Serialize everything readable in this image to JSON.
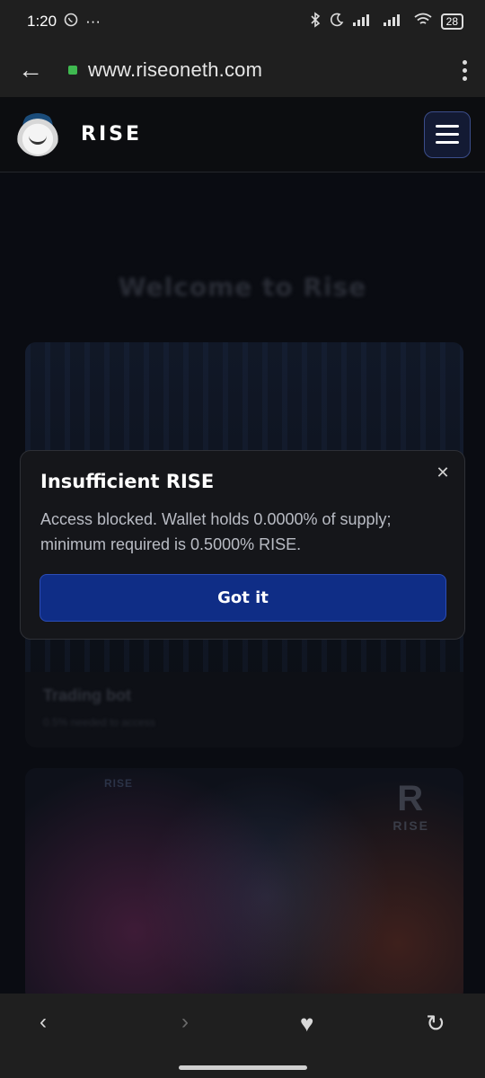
{
  "status_bar": {
    "time": "1:20",
    "whatsapp_icon": "whatsapp-icon",
    "more_text": "···",
    "icons": [
      "bluetooth-icon",
      "moon-icon",
      "signal-icon",
      "signal-icon",
      "wifi-icon"
    ],
    "battery": "28"
  },
  "browser": {
    "url": "www.riseoneth.com",
    "secure_icon": "lock-icon"
  },
  "site_header": {
    "brand": "RISE",
    "menu_icon": "hamburger-icon"
  },
  "page": {
    "welcome_title": "Welcome to Rise",
    "card": {
      "title": "Trading bot",
      "subtitle": "0.5% needed to access"
    },
    "image_card": {
      "watermark": "RISE",
      "watermark_left": "RISE"
    }
  },
  "modal": {
    "title": "Insufficient RISE",
    "message": "Access blocked. Wallet holds 0.0000% of supply; minimum required is 0.5000% RISE.",
    "button_label": "Got it",
    "close_glyph": "✕"
  },
  "bottom_nav": {
    "back_glyph": "‹",
    "forward_glyph": "›",
    "heart_glyph": "♥",
    "sync_glyph": "↻"
  },
  "colors": {
    "accent": "#0f2d86",
    "background": "#0b0d12",
    "modal_bg": "#15161a"
  }
}
